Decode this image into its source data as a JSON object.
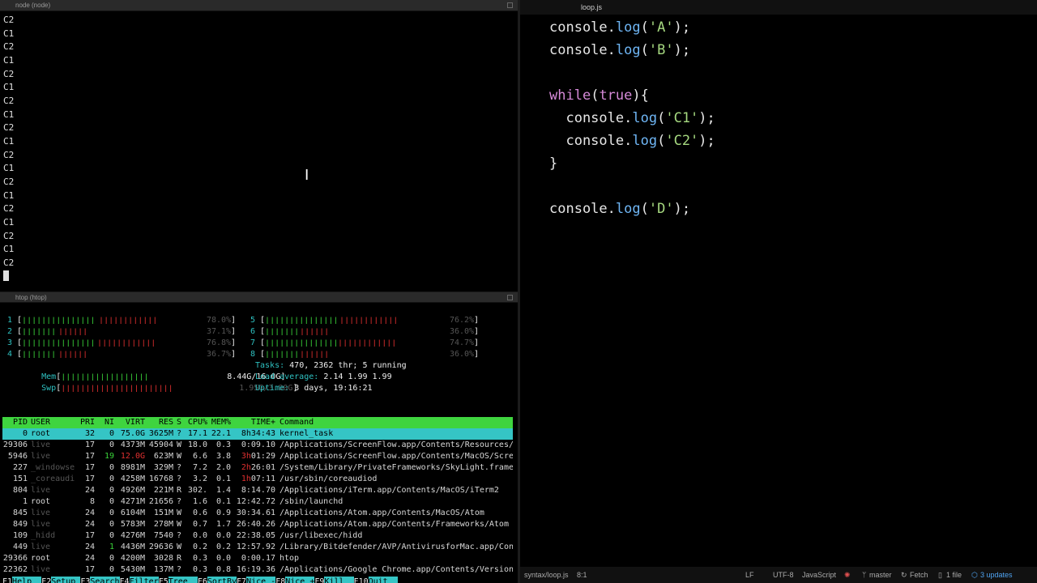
{
  "node_pane": {
    "title": "node (node)",
    "output": [
      "C2",
      "C1",
      "C2",
      "C1",
      "C2",
      "C1",
      "C2",
      "C1",
      "C2",
      "C1",
      "C2",
      "C1",
      "C2",
      "C1",
      "C2",
      "C1",
      "C2",
      "C1",
      "C2"
    ]
  },
  "htop": {
    "title": "htop (htop)",
    "cpus": [
      {
        "num": "1",
        "pct": "78.0%",
        "fill": 0.78
      },
      {
        "num": "2",
        "pct": "37.1%",
        "fill": 0.371
      },
      {
        "num": "3",
        "pct": "76.8%",
        "fill": 0.768
      },
      {
        "num": "4",
        "pct": "36.7%",
        "fill": 0.367
      },
      {
        "num": "5",
        "pct": "76.2%",
        "fill": 0.762
      },
      {
        "num": "6",
        "pct": "36.0%",
        "fill": 0.36
      },
      {
        "num": "7",
        "pct": "74.7%",
        "fill": 0.747
      },
      {
        "num": "8",
        "pct": "36.0%",
        "fill": 0.36
      }
    ],
    "mem": {
      "label": "Mem",
      "value": "8.44G/16.0G",
      "fill": 0.53
    },
    "swp": {
      "label": "Swp",
      "value": "1.95G/3.00G",
      "fill": 0.65
    },
    "tasks": {
      "label": "Tasks:",
      "value": "470, 2362 thr; 5 running"
    },
    "load": {
      "label": "Load average:",
      "value": "2.14 1.99 1.99"
    },
    "uptime": {
      "label": "Uptime:",
      "value": "3 days, 19:16:21"
    },
    "columns": [
      "PID",
      "USER",
      "PRI",
      "NI",
      "VIRT",
      "RES",
      "S",
      "CPU%",
      "MEM%",
      "TIME+",
      "Command"
    ],
    "processes": [
      {
        "pid": "0",
        "user": "root",
        "pri": "32",
        "ni": "0",
        "virt": "75.0G",
        "res": "3625M",
        "s": "?",
        "cpu": "17.1",
        "mem": "22.1",
        "time": "8h34:43",
        "cmd": "kernel_task",
        "selected": true
      },
      {
        "pid": "29306",
        "user": "live",
        "pri": "17",
        "ni": "0",
        "virt": "4373M",
        "res": "45904",
        "s": "W",
        "cpu": "18.0",
        "mem": "0.3",
        "time": "0:09.10",
        "cmd": "/Applications/ScreenFlow.app/Contents/Resources/"
      },
      {
        "pid": "5946",
        "user": "live",
        "pri": "17",
        "ni": "19",
        "virt": "12.0G",
        "res": "623M",
        "s": "W",
        "cpu": "6.6",
        "mem": "3.8",
        "time": "3h01:29",
        "cmd": "/Applications/ScreenFlow.app/Contents/MacOS/Scre"
      },
      {
        "pid": "227",
        "user": "_windowse",
        "pri": "17",
        "ni": "0",
        "virt": "8981M",
        "res": "329M",
        "s": "?",
        "cpu": "7.2",
        "mem": "2.0",
        "time": "2h26:01",
        "cmd": "/System/Library/PrivateFrameworks/SkyLight.frame"
      },
      {
        "pid": "151",
        "user": "_coreaudi",
        "pri": "17",
        "ni": "0",
        "virt": "4258M",
        "res": "16768",
        "s": "?",
        "cpu": "3.2",
        "mem": "0.1",
        "time": "1h07:11",
        "cmd": "/usr/sbin/coreaudiod"
      },
      {
        "pid": "804",
        "user": "live",
        "pri": "24",
        "ni": "0",
        "virt": "4926M",
        "res": "221M",
        "s": "R",
        "cpu": "302.",
        "mem": "1.4",
        "time": "8:14.70",
        "cmd": "/Applications/iTerm.app/Contents/MacOS/iTerm2"
      },
      {
        "pid": "1",
        "user": "root",
        "pri": "8",
        "ni": "0",
        "virt": "4271M",
        "res": "21656",
        "s": "?",
        "cpu": "1.6",
        "mem": "0.1",
        "time": "12:42.72",
        "cmd": "/sbin/launchd"
      },
      {
        "pid": "845",
        "user": "live",
        "pri": "24",
        "ni": "0",
        "virt": "6104M",
        "res": "151M",
        "s": "W",
        "cpu": "0.6",
        "mem": "0.9",
        "time": "30:34.61",
        "cmd": "/Applications/Atom.app/Contents/MacOS/Atom"
      },
      {
        "pid": "849",
        "user": "live",
        "pri": "24",
        "ni": "0",
        "virt": "5783M",
        "res": "278M",
        "s": "W",
        "cpu": "0.7",
        "mem": "1.7",
        "time": "26:40.26",
        "cmd": "/Applications/Atom.app/Contents/Frameworks/Atom"
      },
      {
        "pid": "109",
        "user": "_hidd",
        "pri": "17",
        "ni": "0",
        "virt": "4276M",
        "res": "7540",
        "s": "?",
        "cpu": "0.0",
        "mem": "0.0",
        "time": "22:38.05",
        "cmd": "/usr/libexec/hidd"
      },
      {
        "pid": "449",
        "user": "live",
        "pri": "24",
        "ni": "1",
        "virt": "4436M",
        "res": "29636",
        "s": "W",
        "cpu": "0.2",
        "mem": "0.2",
        "time": "12:57.92",
        "cmd": "/Library/Bitdefender/AVP/AntivirusforMac.app/Con"
      },
      {
        "pid": "29366",
        "user": "root",
        "pri": "24",
        "ni": "0",
        "virt": "4200M",
        "res": "3028",
        "s": "R",
        "cpu": "0.3",
        "mem": "0.0",
        "time": "0:00.17",
        "cmd": "htop"
      },
      {
        "pid": "22362",
        "user": "live",
        "pri": "17",
        "ni": "0",
        "virt": "5430M",
        "res": "137M",
        "s": "?",
        "cpu": "0.3",
        "mem": "0.8",
        "time": "16:19.36",
        "cmd": "/Applications/Google Chrome.app/Contents/Version"
      }
    ],
    "fkeys": [
      {
        "key": "F1",
        "label": "Help  "
      },
      {
        "key": "F2",
        "label": "Setup "
      },
      {
        "key": "F3",
        "label": "Search"
      },
      {
        "key": "F4",
        "label": "Filter"
      },
      {
        "key": "F5",
        "label": "Tree  "
      },
      {
        "key": "F6",
        "label": "SortBy"
      },
      {
        "key": "F7",
        "label": "Nice -"
      },
      {
        "key": "F8",
        "label": "Nice +"
      },
      {
        "key": "F9",
        "label": "Kill  "
      },
      {
        "key": "F10",
        "label": "Quit  "
      }
    ]
  },
  "editor": {
    "tab_title": "loop.js",
    "lines": [
      [
        {
          "t": "console",
          "c": "pun"
        },
        {
          "t": ".",
          "c": "pun"
        },
        {
          "t": "log",
          "c": "fn"
        },
        {
          "t": "(",
          "c": "pun"
        },
        {
          "t": "'A'",
          "c": "str"
        },
        {
          "t": ");",
          "c": "pun"
        }
      ],
      [
        {
          "t": "console",
          "c": "pun"
        },
        {
          "t": ".",
          "c": "pun"
        },
        {
          "t": "log",
          "c": "fn"
        },
        {
          "t": "(",
          "c": "pun"
        },
        {
          "t": "'B'",
          "c": "str"
        },
        {
          "t": ");",
          "c": "pun"
        }
      ],
      [],
      [
        {
          "t": "while",
          "c": "kw"
        },
        {
          "t": "(",
          "c": "pun"
        },
        {
          "t": "true",
          "c": "kw"
        },
        {
          "t": "){",
          "c": "pun"
        }
      ],
      [
        {
          "t": "  console",
          "c": "pun"
        },
        {
          "t": ".",
          "c": "pun"
        },
        {
          "t": "log",
          "c": "fn"
        },
        {
          "t": "(",
          "c": "pun"
        },
        {
          "t": "'C1'",
          "c": "str"
        },
        {
          "t": ");",
          "c": "pun"
        }
      ],
      [
        {
          "t": "  console",
          "c": "pun"
        },
        {
          "t": ".",
          "c": "pun"
        },
        {
          "t": "log",
          "c": "fn"
        },
        {
          "t": "(",
          "c": "pun"
        },
        {
          "t": "'C2'",
          "c": "str"
        },
        {
          "t": ");",
          "c": "pun"
        }
      ],
      [
        {
          "t": "}",
          "c": "pun"
        }
      ],
      [],
      [
        {
          "t": "console",
          "c": "pun"
        },
        {
          "t": ".",
          "c": "pun"
        },
        {
          "t": "log",
          "c": "fn"
        },
        {
          "t": "(",
          "c": "pun"
        },
        {
          "t": "'D'",
          "c": "str"
        },
        {
          "t": ");",
          "c": "pun"
        }
      ]
    ],
    "status": {
      "file": "syntax/loop.js",
      "position": "8:1",
      "line_ending": "LF",
      "encoding": "UTF-8",
      "grammar": "JavaScript",
      "branch": "master",
      "fetch": "Fetch",
      "files": "1 file",
      "updates": "3 updates"
    }
  }
}
